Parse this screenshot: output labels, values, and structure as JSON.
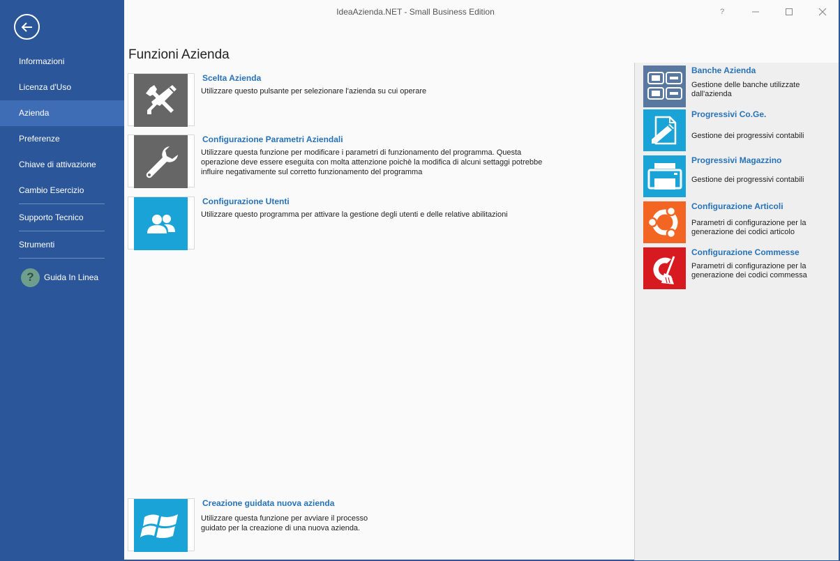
{
  "window": {
    "title": "IdeaAzienda.NET - Small Business Edition"
  },
  "sidebar": {
    "items": [
      {
        "label": "Informazioni"
      },
      {
        "label": "Licenza d'Uso"
      },
      {
        "label": "Azienda"
      },
      {
        "label": "Preferenze"
      },
      {
        "label": "Chiave di attivazione"
      },
      {
        "label": "Cambio Esercizio"
      },
      {
        "label": "Supporto Tecnico"
      },
      {
        "label": "Strumenti"
      }
    ],
    "active": "Azienda",
    "help_label": "Guida In Linea"
  },
  "page": {
    "title": "Funzioni Azienda"
  },
  "functions": [
    {
      "title": "Scelta Azienda",
      "desc": "Utilizzare questo pulsante per selezionare l'azienda su cui operare",
      "icon": "tools-icon"
    },
    {
      "title": "Configurazione Parametri Aziendali",
      "desc": "Utilizzare questa funzione per modificare i parametri di funzionamento del programma. Questa operazione deve essere eseguita con molta attenzione poichè la modifica di alcuni settaggi potrebbe influire negativamente sul corretto funzionamento del programma",
      "icon": "wrench-icon"
    },
    {
      "title": "Configurazione Utenti",
      "desc": "Utilizzare questo programma per attivare la gestione degli utenti e delle relative abilitazioni",
      "icon": "users-icon"
    },
    {
      "title": "Creazione guidata nuova azienda",
      "desc": "Utilizzare questa funzione per avviare il processo guidato per la creazione di una nuova azienda.",
      "icon": "windows-icon"
    }
  ],
  "right_panel": [
    {
      "title": "Banche Azienda",
      "desc": "Gestione delle banche utilizzate dall'azienda",
      "icon": "bank-icon",
      "color": "#5878a0"
    },
    {
      "title": "Progressivi Co.Ge.",
      "desc": "Gestione dei progressivi contabili",
      "icon": "edit-document-icon",
      "color": "#1aa3d7"
    },
    {
      "title": "Progressivi Magazzino",
      "desc": "Gestione dei progressivi contabili",
      "icon": "printer-icon",
      "color": "#1aa3d7"
    },
    {
      "title": "Configurazione Articoli",
      "desc": "Parametri di configurazione per la generazione dei codici articolo",
      "icon": "ubuntu-icon",
      "color": "#f26522"
    },
    {
      "title": "Configurazione Commesse",
      "desc": "Parametri di configurazione per la generazione dei codici commessa",
      "icon": "ccleaner-icon",
      "color": "#d71920"
    }
  ],
  "colors": {
    "sidebar": "#2b579a",
    "sidebar_active": "#3e6db5",
    "link": "#2873b8",
    "tile_gray": "#666666",
    "tile_blue": "#1aa3d7"
  }
}
